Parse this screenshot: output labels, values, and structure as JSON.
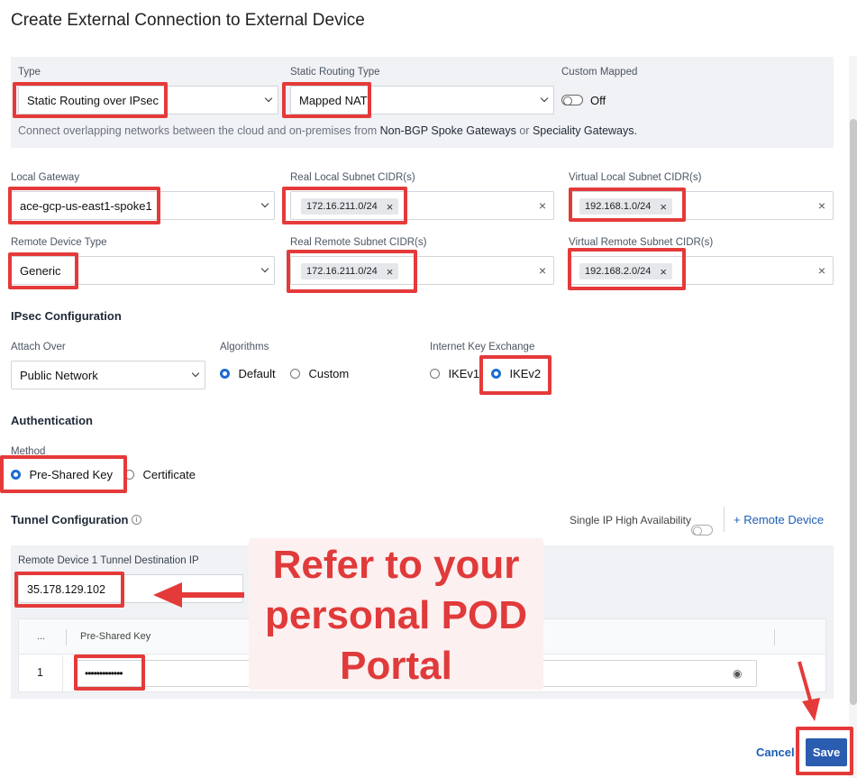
{
  "title": "Create External Connection to External Device",
  "type_section": {
    "type_label": "Type",
    "type_value": "Static Routing over IPsec",
    "static_routing_type_label": "Static Routing Type",
    "static_routing_type_value": "Mapped NAT",
    "custom_mapped_label": "Custom Mapped",
    "custom_mapped_state": "Off",
    "hint_prefix": "Connect overlapping networks between the cloud and on-premises from",
    "hint_link1": "Non-BGP Spoke Gateways",
    "hint_or": "or",
    "hint_link2": "Speciality Gateways."
  },
  "local": {
    "local_gateway_label": "Local Gateway",
    "local_gateway_value": "ace-gcp-us-east1-spoke1",
    "real_local_label": "Real Local Subnet CIDR(s)",
    "real_local_chip": "172.16.211.0/24",
    "virtual_local_label": "Virtual Local Subnet CIDR(s)",
    "virtual_local_chip": "192.168.1.0/24"
  },
  "remote": {
    "remote_device_type_label": "Remote Device Type",
    "remote_device_type_value": "Generic",
    "real_remote_label": "Real Remote Subnet CIDR(s)",
    "real_remote_chip": "172.16.211.0/24",
    "virtual_remote_label": "Virtual Remote Subnet CIDR(s)",
    "virtual_remote_chip": "192.168.2.0/24"
  },
  "ipsec": {
    "heading": "IPsec Configuration",
    "attach_over_label": "Attach Over",
    "attach_over_value": "Public Network",
    "algorithms_label": "Algorithms",
    "alg_default": "Default",
    "alg_custom": "Custom",
    "alg_selected": "Default",
    "ike_label": "Internet Key Exchange",
    "ike_v1": "IKEv1",
    "ike_v2": "IKEv2",
    "ike_selected": "IKEv2"
  },
  "auth": {
    "heading": "Authentication",
    "method_label": "Method",
    "psk": "Pre-Shared Key",
    "cert": "Certificate",
    "selected": "Pre-Shared Key"
  },
  "tunnel": {
    "heading": "Tunnel Configuration",
    "single_ip_ha_label": "Single IP High Availability",
    "add_remote_device": "+ Remote Device",
    "dest_ip_label": "Remote Device 1 Tunnel Destination IP",
    "dest_ip_value": "35.178.129.102",
    "table_col_index": "...",
    "table_col_psk": "Pre-Shared Key",
    "row_index": "1",
    "row_psk_masked": "•••••••••••••"
  },
  "annotation": {
    "callout_line1": "Refer to your",
    "callout_line2": "personal POD",
    "callout_line3": "Portal"
  },
  "footer": {
    "cancel": "Cancel",
    "save": "Save"
  },
  "colors": {
    "accent": "#1c6dd0",
    "save_bg": "#2a5db0",
    "annotation_red": "#e53a3a",
    "panel_bg": "#f1f2f5"
  }
}
